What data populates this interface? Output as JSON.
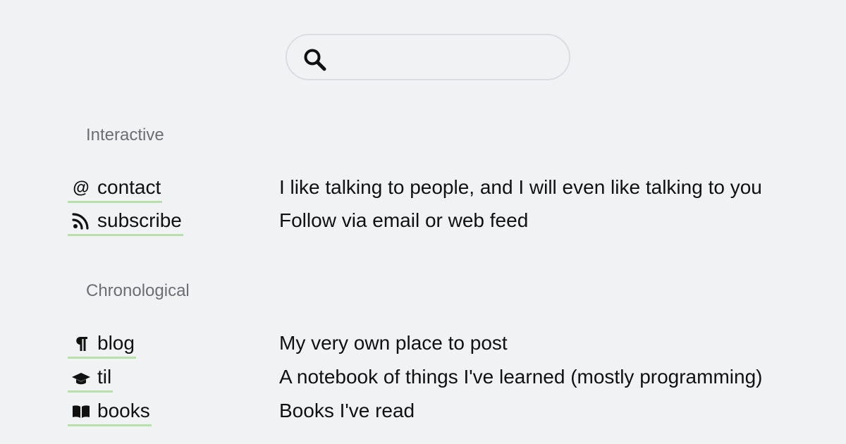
{
  "search": {
    "value": "",
    "placeholder": ""
  },
  "sections": [
    {
      "title": "Interactive",
      "items": [
        {
          "label": "contact",
          "icon": "at-icon",
          "description": "I like talking to people, and I will even like talking to you"
        },
        {
          "label": "subscribe",
          "icon": "rss-icon",
          "description": "Follow via email or web feed"
        }
      ]
    },
    {
      "title": "Chronological",
      "items": [
        {
          "label": "blog",
          "icon": "pilcrow-icon",
          "description": "My very own place to post"
        },
        {
          "label": "til",
          "icon": "graduation-cap-icon",
          "description": "A notebook of things I've learned (mostly programming)"
        },
        {
          "label": "books",
          "icon": "book-icon",
          "description": "Books I've read"
        }
      ]
    }
  ],
  "colors": {
    "background": "#f1f2f4",
    "link_underline": "#b5e0a9",
    "section_title": "#6b6e72",
    "text": "#111111"
  }
}
